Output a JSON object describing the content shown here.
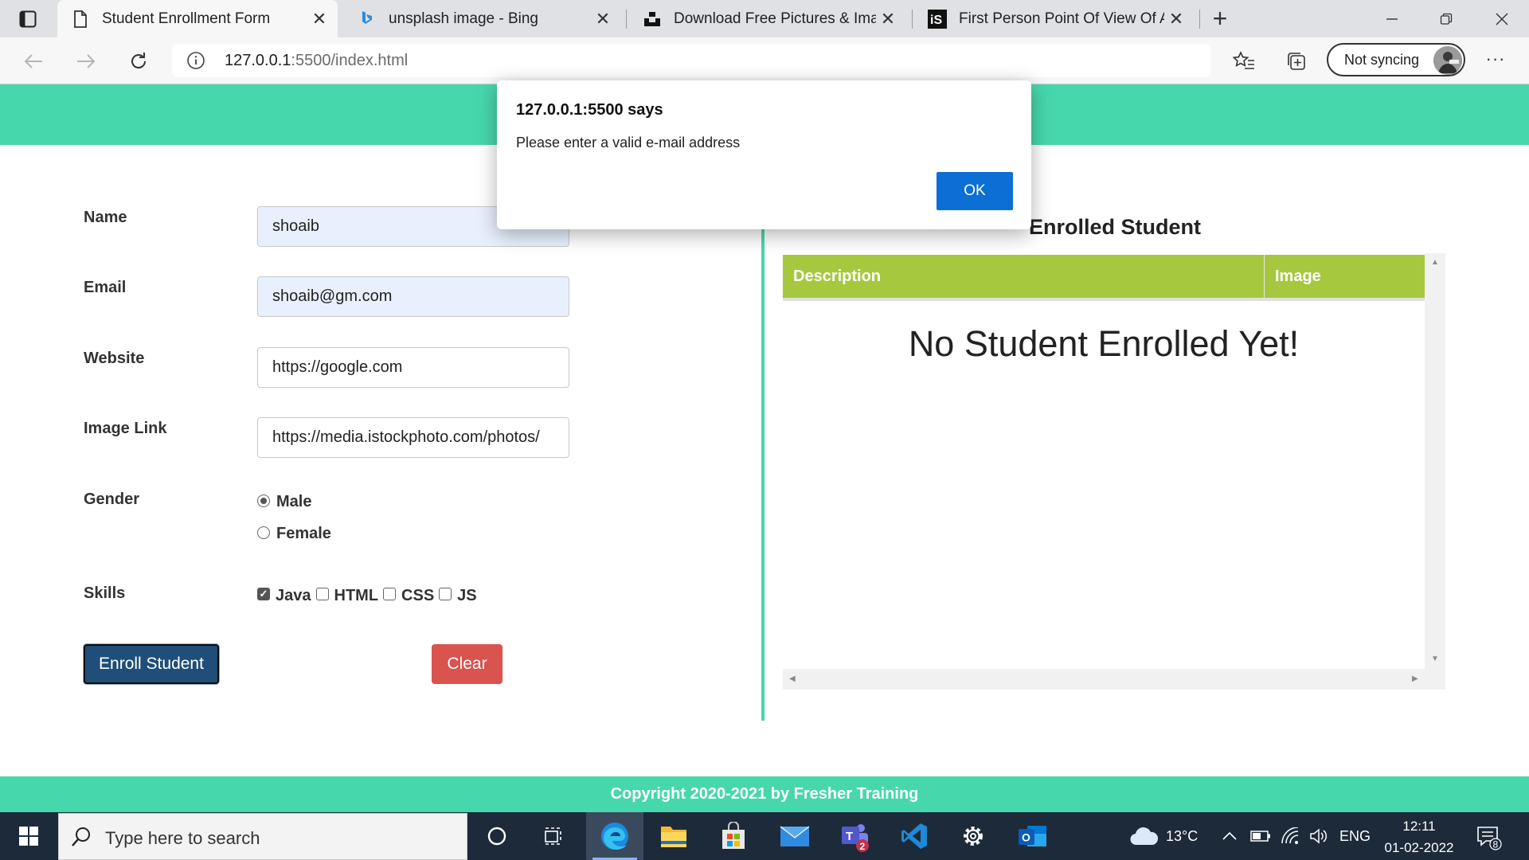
{
  "browser": {
    "tabs": [
      {
        "title": "Student Enrollment Form",
        "active": true,
        "icon": "page-icon"
      },
      {
        "title": "unsplash image - Bing",
        "active": false,
        "icon": "bing-icon"
      },
      {
        "title": "Download Free Pictures & Image",
        "active": false,
        "icon": "unsplash-icon"
      },
      {
        "title": "First Person Point Of View Of A W",
        "active": false,
        "icon": "istock-icon"
      }
    ],
    "url_host": "127.0.0.1",
    "url_path": ":5500/index.html",
    "sync_label": "Not syncing"
  },
  "form": {
    "name_label": "Name",
    "name_value": "shoaib",
    "email_label": "Email",
    "email_value": "shoaib@gm.com",
    "website_label": "Website",
    "website_value": "https://google.com",
    "image_label": "Image Link",
    "image_value": "https://media.istockphoto.com/photos/",
    "gender_label": "Gender",
    "gender_options": [
      {
        "label": "Male",
        "checked": true
      },
      {
        "label": "Female",
        "checked": false
      }
    ],
    "skills_label": "Skills",
    "skills": [
      {
        "label": "Java",
        "checked": true
      },
      {
        "label": "HTML",
        "checked": false
      },
      {
        "label": "CSS",
        "checked": false
      },
      {
        "label": "JS",
        "checked": false
      }
    ],
    "enroll_label": "Enroll Student",
    "clear_label": "Clear"
  },
  "enrolled": {
    "title": "Enrolled Student",
    "col_description": "Description",
    "col_image": "Image",
    "empty_message": "No Student Enrolled Yet!"
  },
  "footer": {
    "text": "Copyright 2020-2021 by Fresher Training"
  },
  "dialog": {
    "title": "127.0.0.1:5500 says",
    "message": "Please enter a valid e-mail address",
    "ok_label": "OK"
  },
  "taskbar": {
    "search_placeholder": "Type here to search",
    "temperature": "13°C",
    "language": "ENG",
    "time": "12:11",
    "date": "01-02-2022",
    "teams_badge": "2",
    "notification_count": "8"
  },
  "colors": {
    "accent_teal": "#47d7ac",
    "table_header": "#a6c83e",
    "enroll_button": "#1f4e79",
    "clear_button": "#d9534f",
    "dialog_ok": "#0b6fd6"
  }
}
